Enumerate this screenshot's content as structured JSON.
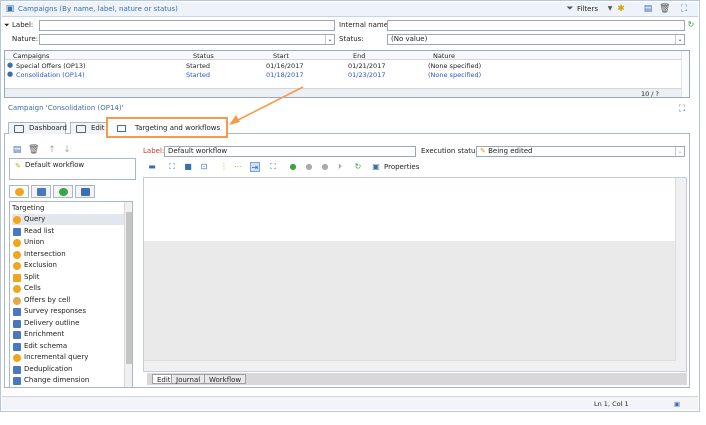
{
  "header": {
    "title": "Campaigns (By name, label, nature or status)",
    "filters_label": "Filters"
  },
  "filter": {
    "label_label": "Label:",
    "internal_name_label": "Internal name:",
    "nature_label": "Nature:",
    "status_label": "Status:",
    "status_value": "(No value)"
  },
  "grid": {
    "columns": [
      "Campaigns",
      "Status",
      "Start",
      "End",
      "Nature"
    ],
    "rows": [
      {
        "name": "Special Offers (OP13)",
        "status": "Started",
        "start": "01/16/2017",
        "end": "01/21/2017",
        "nature": "(None specified)"
      },
      {
        "name": "Consolidation (OP14)",
        "status": "Started",
        "start": "01/18/2017",
        "end": "01/23/2017",
        "nature": "(None specified)"
      }
    ],
    "pager": "10 / ?"
  },
  "campaign": {
    "title": "Campaign 'Consolidation (OP14)'",
    "tabs": [
      "Dashboard",
      "Edit",
      "Targeting and workflows"
    ]
  },
  "workflow": {
    "list_item": "Default workflow",
    "label_label": "Label:",
    "label_value": "Default workflow",
    "exec_status_label": "Execution status:",
    "exec_status_value": "Being edited",
    "properties_label": "Properties"
  },
  "palette": {
    "section": "Targeting",
    "items": [
      "Query",
      "Read list",
      "Union",
      "Intersection",
      "Exclusion",
      "Split",
      "Cells",
      "Offers by cell",
      "Survey responses",
      "Delivery outline",
      "Enrichment",
      "Edit schema",
      "Incremental query",
      "Deduplication",
      "Change dimension"
    ]
  },
  "bottom_tabs": [
    "Edit",
    "Journal",
    "Workflow"
  ],
  "status": {
    "position": "Ln 1, Col 1"
  },
  "colors": {
    "accent": "#3c6ea8",
    "highlight": "#f49a4a"
  }
}
